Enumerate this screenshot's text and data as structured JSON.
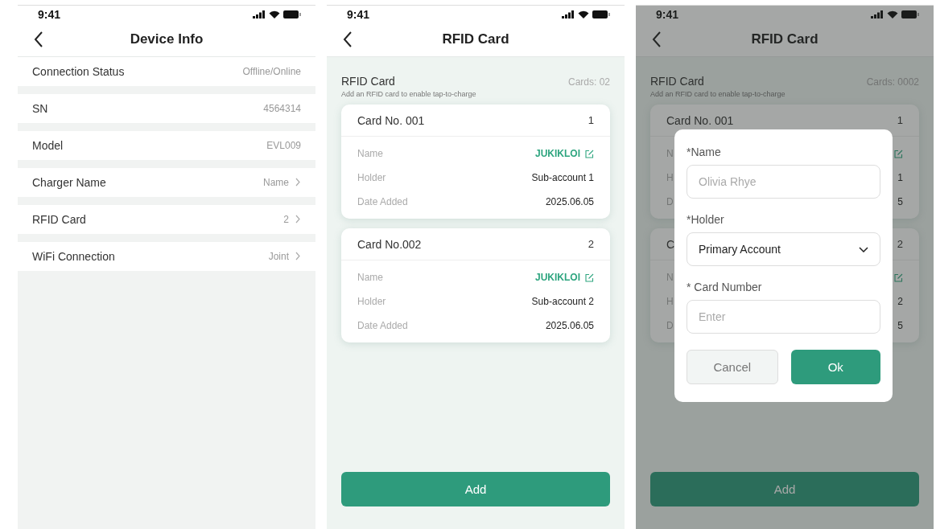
{
  "screens": [
    {
      "kind": "device_info",
      "status_bar": {
        "time": "9:41"
      },
      "title": "Device Info",
      "rows": [
        {
          "label": "Connection Status",
          "value": "Offline/Online",
          "chevron": false
        },
        {
          "label": "SN",
          "value": "4564314",
          "chevron": false
        },
        {
          "label": "Model",
          "value": "EVL009",
          "chevron": false
        },
        {
          "label": "Charger Name",
          "value": "Name",
          "chevron": true
        },
        {
          "label": "RFID Card",
          "value": "2",
          "chevron": true
        },
        {
          "label": "WiFi Connection",
          "value": "Joint",
          "chevron": true
        }
      ]
    },
    {
      "kind": "rfid_list",
      "status_bar": {
        "time": "9:41"
      },
      "title": "RFID Card",
      "section": {
        "title": "RFID Card",
        "count": "Cards: 02",
        "subtitle": "Add an RFID card to enable tap-to-charge"
      },
      "cards": [
        {
          "title": "Card No. 001",
          "number": "1",
          "fields": [
            {
              "label": "Name",
              "value": "JUKIKLOI",
              "editable": true
            },
            {
              "label": "Holder",
              "value": "Sub-account 1",
              "editable": false
            },
            {
              "label": "Date Added",
              "value": "2025.06.05",
              "editable": false
            }
          ]
        },
        {
          "title": "Card No.002",
          "number": "2",
          "fields": [
            {
              "label": "Name",
              "value": "JUKIKLOI",
              "editable": true
            },
            {
              "label": "Holder",
              "value": "Sub-account 2",
              "editable": false
            },
            {
              "label": "Date Added",
              "value": "2025.06.05",
              "editable": false
            }
          ]
        }
      ],
      "add_button": "Add"
    },
    {
      "kind": "rfid_dialog",
      "status_bar": {
        "time": "9:41"
      },
      "title": "RFID Card",
      "section": {
        "title": "RFID Card",
        "count": "Cards: 0002",
        "subtitle": "Add an RFID card to enable tap-to-charge"
      },
      "cards": [
        {
          "title": "Card No. 001",
          "number": "1",
          "fields": [
            {
              "label": "N",
              "editable": true
            },
            {
              "label": "H",
              "value": "1",
              "editable": false
            },
            {
              "label": "D",
              "value": "5",
              "editable": false
            }
          ]
        },
        {
          "title": "C",
          "number": "2",
          "fields": [
            {
              "label": "N",
              "editable": true
            },
            {
              "label": "H",
              "value": "2",
              "editable": false
            },
            {
              "label": "D",
              "value": "5",
              "editable": false
            }
          ]
        }
      ],
      "add_button": "Add",
      "dialog": {
        "fields": [
          {
            "kind": "input",
            "label": "*Name",
            "placeholder": "Olivia Rhye"
          },
          {
            "kind": "select",
            "label": "*Holder",
            "value": "Primary Account"
          },
          {
            "kind": "input",
            "label": "* Card Number",
            "placeholder": "Enter"
          }
        ],
        "buttons": [
          {
            "kind": "secondary",
            "label": "Cancel"
          },
          {
            "kind": "primary",
            "label": "Ok"
          }
        ]
      }
    }
  ]
}
